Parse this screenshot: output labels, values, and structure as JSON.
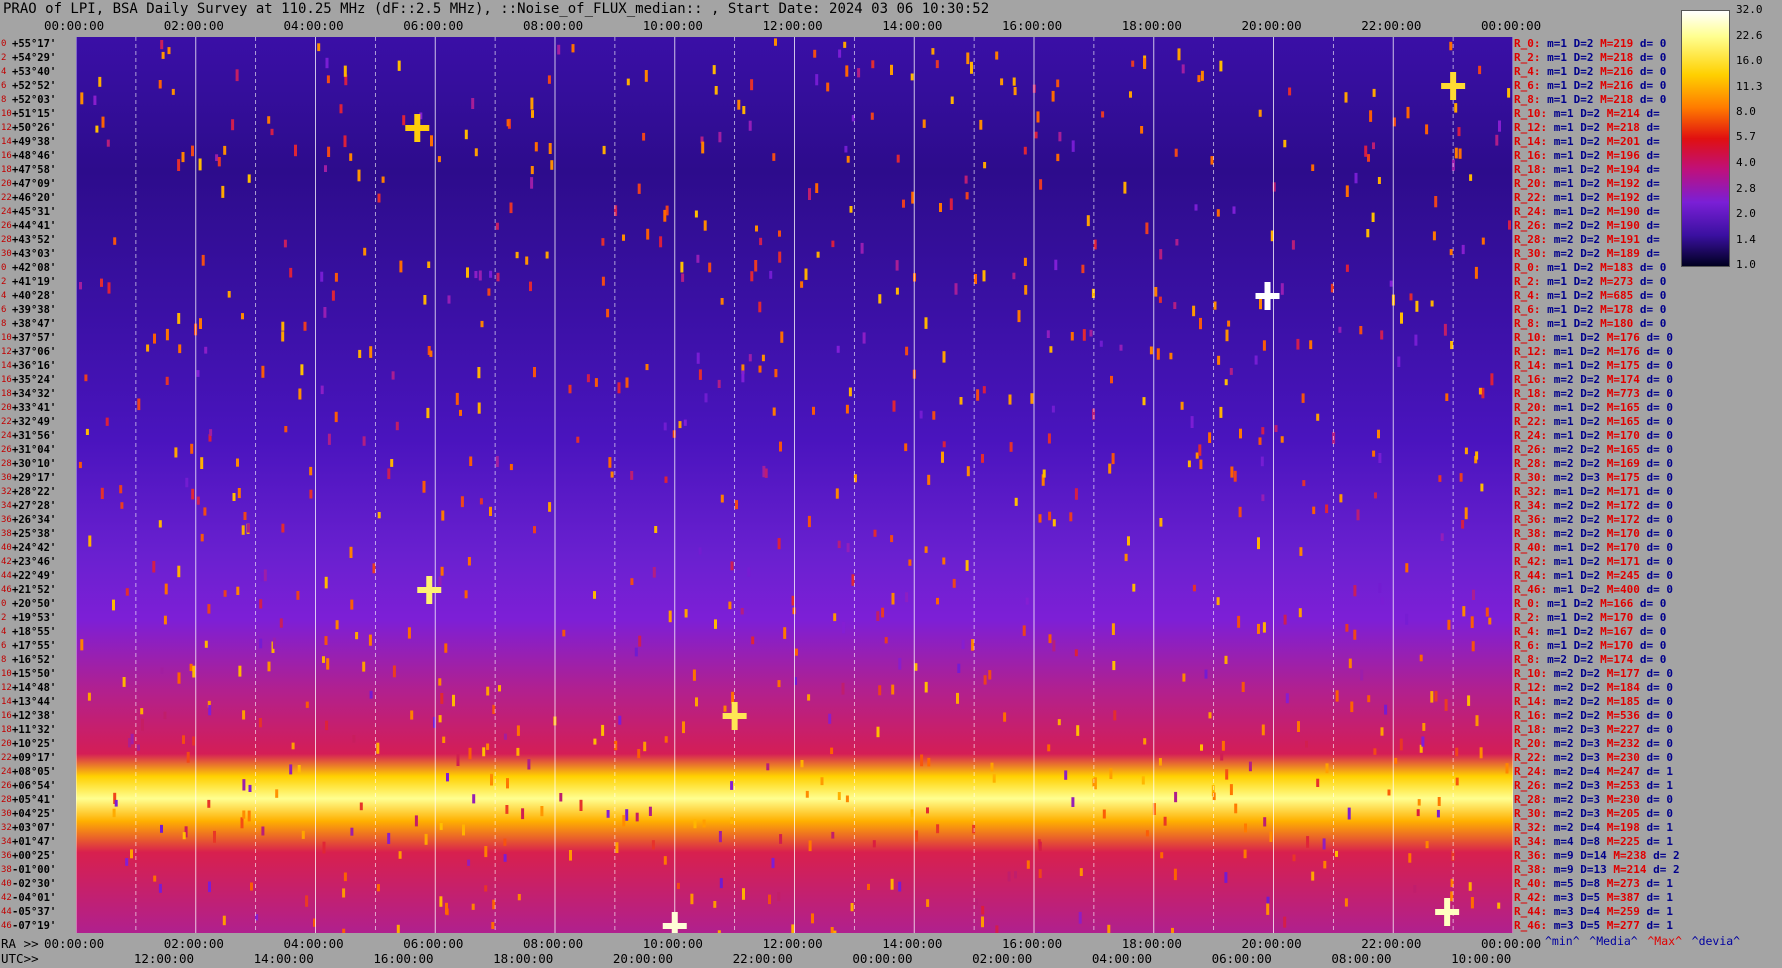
{
  "header": {
    "title": "PRAO of LPI, BSA Daily Survey at 110.25 MHz (dF::2.5 MHz), ::Noise_of_FLUX_median:: , Start Date: 2024 03 06 10:30:52"
  },
  "chart_data": {
    "type": "heatmap",
    "title": "PRAO of LPI, BSA Daily Survey at 110.25 MHz (dF::2.5 MHz), ::Noise_of_FLUX_median:: , Start Date: 2024 03 06 10:30:52",
    "top_axis_ticks": [
      "00:00:00",
      "02:00:00",
      "04:00:00",
      "06:00:00",
      "08:00:00",
      "10:00:00",
      "12:00:00",
      "14:00:00",
      "16:00:00",
      "18:00:00",
      "20:00:00",
      "22:00:00",
      "00:00:00"
    ],
    "ra_prefix": "RA >>",
    "ra_ticks": [
      "00:00:00",
      "02:00:00",
      "04:00:00",
      "06:00:00",
      "08:00:00",
      "10:00:00",
      "12:00:00",
      "14:00:00",
      "16:00:00",
      "18:00:00",
      "20:00:00",
      "22:00:00",
      "00:00:00"
    ],
    "utc_prefix": "UTC>>",
    "utc_ticks": [
      "12:00:00",
      "14:00:00",
      "16:00:00",
      "18:00:00",
      "20:00:00",
      "22:00:00",
      "00:00:00",
      "02:00:00",
      "04:00:00",
      "06:00:00",
      "08:00:00",
      "10:00:00"
    ],
    "dec_labels": [
      "+55°17'",
      "+54°29'",
      "+53°40'",
      "+52°52'",
      "+52°03'",
      "+51°15'",
      "+50°26'",
      "+49°38'",
      "+48°46'",
      "+47°58'",
      "+47°09'",
      "+46°20'",
      "+45°31'",
      "+44°41'",
      "+43°52'",
      "+43°03'",
      "+42°08'",
      "+41°19'",
      "+40°28'",
      "+39°38'",
      "+38°47'",
      "+37°57'",
      "+37°06'",
      "+36°16'",
      "+35°24'",
      "+34°32'",
      "+33°41'",
      "+32°49'",
      "+31°56'",
      "+31°04'",
      "+30°10'",
      "+29°17'",
      "+28°22'",
      "+27°28'",
      "+26°34'",
      "+25°38'",
      "+24°42'",
      "+23°46'",
      "+22°49'",
      "+21°52'",
      "+20°50'",
      "+19°53'",
      "+18°55'",
      "+17°55'",
      "+16°52'",
      "+15°50'",
      "+14°48'",
      "+13°44'",
      "+12°38'",
      "+11°32'",
      "+10°25'",
      "+09°17'",
      "+08°05'",
      "+06°54'",
      "+05°41'",
      "+04°25'",
      "+03°07'",
      "+01°47'",
      "+00°25'",
      "-01°00'",
      "-02°30'",
      "-04°01'",
      "-05°37'",
      "-07°19'"
    ],
    "row_index": [
      "0",
      "2",
      "4",
      "6",
      "8",
      "10",
      "12",
      "14",
      "16",
      "18",
      "20",
      "22",
      "24",
      "26",
      "28",
      "30",
      "0",
      "2",
      "4",
      "6",
      "8",
      "10",
      "12",
      "14",
      "16",
      "18",
      "20",
      "22",
      "24",
      "26",
      "28",
      "30",
      "32",
      "34",
      "36",
      "38",
      "40",
      "42",
      "44",
      "46",
      "0",
      "2",
      "4",
      "6",
      "8",
      "10",
      "12",
      "14",
      "16",
      "18",
      "20",
      "22",
      "24",
      "26",
      "28",
      "30",
      "32",
      "34",
      "36",
      "38",
      "40",
      "42",
      "44",
      "46"
    ],
    "stats": [
      {
        "r": "R_0:",
        "m": "m=1",
        "D": "D=2",
        "M": "M=219",
        "d": "d= 0"
      },
      {
        "r": "R_2:",
        "m": "m=1",
        "D": "D=2",
        "M": "M=218",
        "d": "d= 0"
      },
      {
        "r": "R_4:",
        "m": "m=1",
        "D": "D=2",
        "M": "M=216",
        "d": "d= 0"
      },
      {
        "r": "R_6:",
        "m": "m=1",
        "D": "D=2",
        "M": "M=216",
        "d": "d= 0"
      },
      {
        "r": "R_8:",
        "m": "m=1",
        "D": "D=2",
        "M": "M=218",
        "d": "d= 0"
      },
      {
        "r": "R_10:",
        "m": "m=1",
        "D": "D=2",
        "M": "M=214",
        "d": "d="
      },
      {
        "r": "R_12:",
        "m": "m=1",
        "D": "D=2",
        "M": "M=218",
        "d": "d="
      },
      {
        "r": "R_14:",
        "m": "m=1",
        "D": "D=2",
        "M": "M=201",
        "d": "d="
      },
      {
        "r": "R_16:",
        "m": "m=1",
        "D": "D=2",
        "M": "M=196",
        "d": "d="
      },
      {
        "r": "R_18:",
        "m": "m=1",
        "D": "D=2",
        "M": "M=194",
        "d": "d="
      },
      {
        "r": "R_20:",
        "m": "m=1",
        "D": "D=2",
        "M": "M=192",
        "d": "d="
      },
      {
        "r": "R_22:",
        "m": "m=1",
        "D": "D=2",
        "M": "M=192",
        "d": "d="
      },
      {
        "r": "R_24:",
        "m": "m=1",
        "D": "D=2",
        "M": "M=190",
        "d": "d="
      },
      {
        "r": "R_26:",
        "m": "m=2",
        "D": "D=2",
        "M": "M=190",
        "d": "d="
      },
      {
        "r": "R_28:",
        "m": "m=2",
        "D": "D=2",
        "M": "M=191",
        "d": "d="
      },
      {
        "r": "R_30:",
        "m": "m=2",
        "D": "D=2",
        "M": "M=189",
        "d": "d="
      },
      {
        "r": "R_0:",
        "m": "m=1",
        "D": "D=2",
        "M": "M=183",
        "d": "d= 0"
      },
      {
        "r": "R_2:",
        "m": "m=1",
        "D": "D=2",
        "M": "M=273",
        "d": "d= 0"
      },
      {
        "r": "R_4:",
        "m": "m=1",
        "D": "D=2",
        "M": "M=685",
        "d": "d= 0"
      },
      {
        "r": "R_6:",
        "m": "m=1",
        "D": "D=2",
        "M": "M=178",
        "d": "d= 0"
      },
      {
        "r": "R_8:",
        "m": "m=1",
        "D": "D=2",
        "M": "M=180",
        "d": "d= 0"
      },
      {
        "r": "R_10:",
        "m": "m=1",
        "D": "D=2",
        "M": "M=176",
        "d": "d= 0"
      },
      {
        "r": "R_12:",
        "m": "m=1",
        "D": "D=2",
        "M": "M=176",
        "d": "d= 0"
      },
      {
        "r": "R_14:",
        "m": "m=1",
        "D": "D=2",
        "M": "M=175",
        "d": "d= 0"
      },
      {
        "r": "R_16:",
        "m": "m=2",
        "D": "D=2",
        "M": "M=174",
        "d": "d= 0"
      },
      {
        "r": "R_18:",
        "m": "m=2",
        "D": "D=2",
        "M": "M=773",
        "d": "d= 0"
      },
      {
        "r": "R_20:",
        "m": "m=1",
        "D": "D=2",
        "M": "M=165",
        "d": "d= 0"
      },
      {
        "r": "R_22:",
        "m": "m=1",
        "D": "D=2",
        "M": "M=165",
        "d": "d= 0"
      },
      {
        "r": "R_24:",
        "m": "m=1",
        "D": "D=2",
        "M": "M=170",
        "d": "d= 0"
      },
      {
        "r": "R_26:",
        "m": "m=2",
        "D": "D=2",
        "M": "M=165",
        "d": "d= 0"
      },
      {
        "r": "R_28:",
        "m": "m=2",
        "D": "D=2",
        "M": "M=169",
        "d": "d= 0"
      },
      {
        "r": "R_30:",
        "m": "m=2",
        "D": "D=3",
        "M": "M=175",
        "d": "d= 0"
      },
      {
        "r": "R_32:",
        "m": "m=1",
        "D": "D=2",
        "M": "M=171",
        "d": "d= 0"
      },
      {
        "r": "R_34:",
        "m": "m=2",
        "D": "D=2",
        "M": "M=172",
        "d": "d= 0"
      },
      {
        "r": "R_36:",
        "m": "m=2",
        "D": "D=2",
        "M": "M=172",
        "d": "d= 0"
      },
      {
        "r": "R_38:",
        "m": "m=2",
        "D": "D=2",
        "M": "M=170",
        "d": "d= 0"
      },
      {
        "r": "R_40:",
        "m": "m=1",
        "D": "D=2",
        "M": "M=170",
        "d": "d= 0"
      },
      {
        "r": "R_42:",
        "m": "m=1",
        "D": "D=2",
        "M": "M=171",
        "d": "d= 0"
      },
      {
        "r": "R_44:",
        "m": "m=1",
        "D": "D=2",
        "M": "M=245",
        "d": "d= 0"
      },
      {
        "r": "R_46:",
        "m": "m=1",
        "D": "D=2",
        "M": "M=400",
        "d": "d= 0"
      },
      {
        "r": "R_0:",
        "m": "m=1",
        "D": "D=2",
        "M": "M=166",
        "d": "d= 0"
      },
      {
        "r": "R_2:",
        "m": "m=1",
        "D": "D=2",
        "M": "M=170",
        "d": "d= 0"
      },
      {
        "r": "R_4:",
        "m": "m=1",
        "D": "D=2",
        "M": "M=167",
        "d": "d= 0"
      },
      {
        "r": "R_6:",
        "m": "m=1",
        "D": "D=2",
        "M": "M=170",
        "d": "d= 0"
      },
      {
        "r": "R_8:",
        "m": "m=2",
        "D": "D=2",
        "M": "M=174",
        "d": "d= 0"
      },
      {
        "r": "R_10:",
        "m": "m=2",
        "D": "D=2",
        "M": "M=177",
        "d": "d= 0"
      },
      {
        "r": "R_12:",
        "m": "m=2",
        "D": "D=2",
        "M": "M=184",
        "d": "d= 0"
      },
      {
        "r": "R_14:",
        "m": "m=2",
        "D": "D=2",
        "M": "M=185",
        "d": "d= 0"
      },
      {
        "r": "R_16:",
        "m": "m=2",
        "D": "D=2",
        "M": "M=536",
        "d": "d= 0"
      },
      {
        "r": "R_18:",
        "m": "m=2",
        "D": "D=3",
        "M": "M=227",
        "d": "d= 0"
      },
      {
        "r": "R_20:",
        "m": "m=2",
        "D": "D=3",
        "M": "M=232",
        "d": "d= 0"
      },
      {
        "r": "R_22:",
        "m": "m=2",
        "D": "D=3",
        "M": "M=230",
        "d": "d= 0"
      },
      {
        "r": "R_24:",
        "m": "m=2",
        "D": "D=4",
        "M": "M=247",
        "d": "d= 1"
      },
      {
        "r": "R_26:",
        "m": "m=2",
        "D": "D=3",
        "M": "M=253",
        "d": "d= 1"
      },
      {
        "r": "R_28:",
        "m": "m=2",
        "D": "D=3",
        "M": "M=230",
        "d": "d= 0"
      },
      {
        "r": "R_30:",
        "m": "m=2",
        "D": "D=3",
        "M": "M=205",
        "d": "d= 0"
      },
      {
        "r": "R_32:",
        "m": "m=2",
        "D": "D=4",
        "M": "M=198",
        "d": "d= 1"
      },
      {
        "r": "R_34:",
        "m": "m=4",
        "D": "D=8",
        "M": "M=225",
        "d": "d= 1"
      },
      {
        "r": "R_36:",
        "m": "m=9",
        "D": "D=14",
        "M": "M=238",
        "d": "d= 2"
      },
      {
        "r": "R_38:",
        "m": "m=9",
        "D": "D=13",
        "M": "M=214",
        "d": "d= 2"
      },
      {
        "r": "R_40:",
        "m": "m=5",
        "D": "D=8",
        "M": "M=273",
        "d": "d= 1"
      },
      {
        "r": "R_42:",
        "m": "m=3",
        "D": "D=5",
        "M": "M=387",
        "d": "d= 1"
      },
      {
        "r": "R_44:",
        "m": "m=3",
        "D": "D=4",
        "M": "M=259",
        "d": "d= 1"
      },
      {
        "r": "R_46:",
        "m": "m=3",
        "D": "D=5",
        "M": "M=277",
        "d": "d= 1"
      }
    ],
    "colorbar": {
      "labels": [
        "32.0",
        "22.6",
        "16.0",
        "11.3",
        "8.0",
        "5.7",
        "4.0",
        "2.8",
        "2.0",
        "1.4",
        "1.0"
      ],
      "min": 1.0,
      "max": 32.0,
      "scale": "log"
    },
    "footer": [
      "^min^",
      "^Media^",
      "^Max^",
      "^devia^"
    ],
    "features": [
      {
        "ra": 19.9,
        "row": 18,
        "value": 32
      },
      {
        "ra": 5.9,
        "row": 39,
        "value": 20
      },
      {
        "ra": 11.0,
        "row": 48,
        "value": 18
      },
      {
        "ra": 10.0,
        "row": 63,
        "value": 28
      },
      {
        "ra": 22.9,
        "row": 62,
        "value": 26
      },
      {
        "ra": 23.0,
        "row": 3,
        "value": 16
      },
      {
        "ra": 5.7,
        "row": 6,
        "value": 14
      }
    ],
    "colors": {
      "low": "#000033",
      "mid": "#8a2be2",
      "high": "#ff2020",
      "peak": "#ffffe0",
      "background": "#a4a4a4"
    }
  }
}
